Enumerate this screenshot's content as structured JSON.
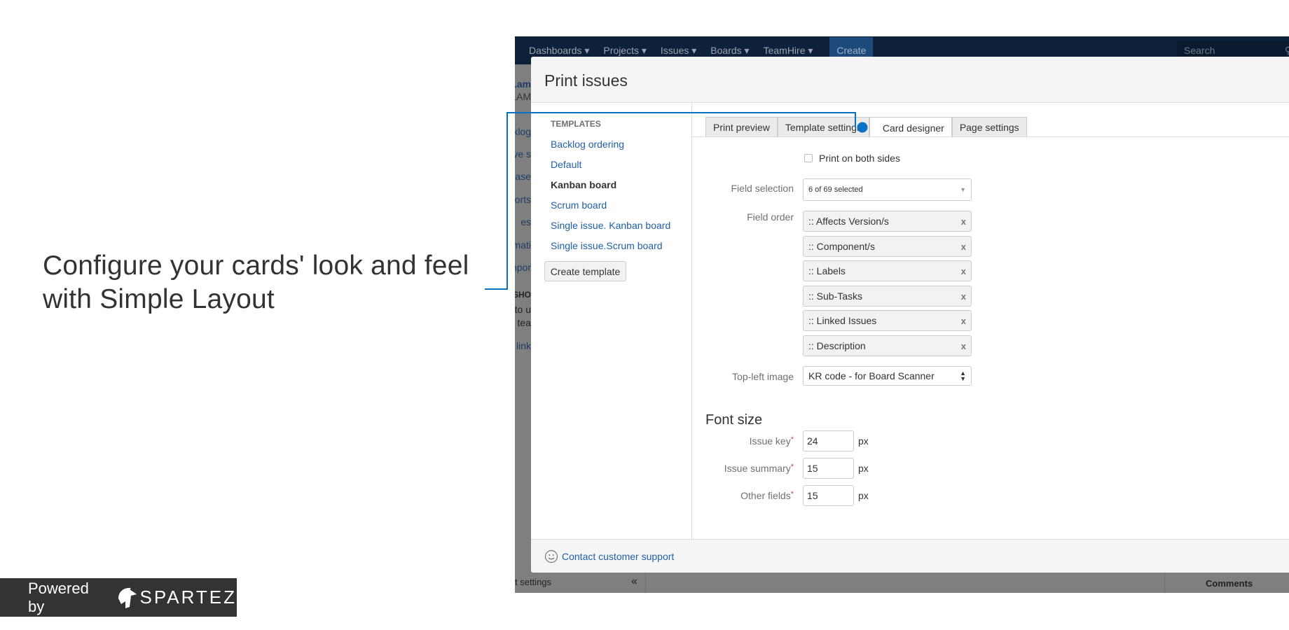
{
  "caption": {
    "line1": "Configure your cards' look and feel",
    "line2": "with Simple Layout"
  },
  "badge": {
    "powered_by": "Powered by",
    "brand": "SPARTEZ"
  },
  "jira": {
    "nav": [
      "Dashboards ▾",
      "Projects ▾",
      "Issues ▾",
      "Boards ▾",
      "TeamHire ▾"
    ],
    "create": "Create",
    "search_placeholder": "Search",
    "sidebar_fragments": [
      "Lam",
      "LAM",
      "klog",
      "ve s",
      "ase",
      "orts",
      "es",
      "mati",
      "npor",
      "SHO",
      "to u",
      "e tea",
      "link"
    ],
    "bottom": {
      "settings": "t settings",
      "collapse": "«",
      "comments": "Comments"
    }
  },
  "dialog": {
    "title": "Print issues",
    "templates": {
      "heading": "TEMPLATES",
      "items": [
        "Backlog ordering",
        "Default",
        "Kanban board",
        "Scrum board",
        "Single issue. Kanban board",
        "Single issue.Scrum board"
      ],
      "current": "Kanban board",
      "create": "Create template"
    },
    "tabs": [
      "Print preview",
      "Template settings",
      "Card designer",
      "Page settings"
    ],
    "active_tab": "Card designer",
    "print_both_sides": {
      "label": "Print on both sides",
      "checked": false
    },
    "field_selection": {
      "label": "Field selection",
      "value": "6 of 69 selected"
    },
    "field_order": {
      "label": "Field order",
      "items": [
        ":: Affects Version/s",
        ":: Component/s",
        ":: Labels",
        ":: Sub-Tasks",
        ":: Linked Issues",
        ":: Description"
      ],
      "remove": "x"
    },
    "top_left_image": {
      "label": "Top-left image",
      "value": "KR code - for Board Scanner"
    },
    "font_size": {
      "heading": "Font size",
      "unit": "px",
      "fields": [
        {
          "label": "Issue key",
          "value": "24"
        },
        {
          "label": "Issue summary",
          "value": "15"
        },
        {
          "label": "Other fields",
          "value": "15"
        }
      ],
      "required_mark": "*"
    },
    "footer": {
      "support": "Contact customer support"
    }
  },
  "colors": {
    "accent": "#0a72c2",
    "link": "#205fa8",
    "nav": "#0e213a",
    "overlay": "#7f7f7f"
  }
}
